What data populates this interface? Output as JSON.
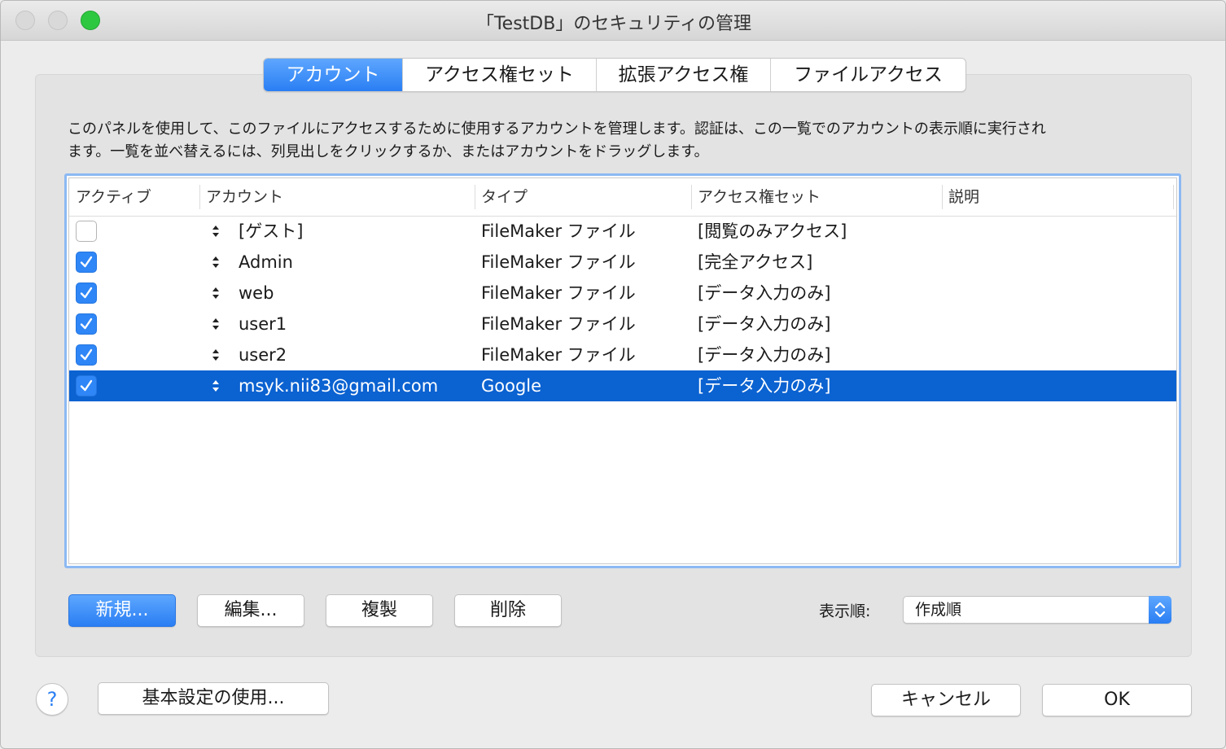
{
  "window": {
    "title": "「TestDB」のセキュリティの管理"
  },
  "tabs": [
    {
      "label": "アカウント",
      "active": true
    },
    {
      "label": "アクセス権セット",
      "active": false
    },
    {
      "label": "拡張アクセス権",
      "active": false
    },
    {
      "label": "ファイルアクセス",
      "active": false
    }
  ],
  "description": {
    "line1": "このパネルを使用して、このファイルにアクセスするために使用するアカウントを管理します。認証は、この一覧でのアカウントの表示順に実行され",
    "line2": "ます。一覧を並べ替えるには、列見出しをクリックするか、またはアカウントをドラッグします。"
  },
  "table": {
    "columns": {
      "active": "アクティブ",
      "account": "アカウント",
      "type": "タイプ",
      "privilege_set": "アクセス権セット",
      "description": "説明"
    },
    "rows": [
      {
        "active": false,
        "account": "[ゲスト]",
        "type": "FileMaker ファイル",
        "privilege_set": "[閲覧のみアクセス]",
        "description": "",
        "selected": false
      },
      {
        "active": true,
        "account": "Admin",
        "type": "FileMaker ファイル",
        "privilege_set": "[完全アクセス]",
        "description": "",
        "selected": false
      },
      {
        "active": true,
        "account": "web",
        "type": "FileMaker ファイル",
        "privilege_set": "[データ入力のみ]",
        "description": "",
        "selected": false
      },
      {
        "active": true,
        "account": "user1",
        "type": "FileMaker ファイル",
        "privilege_set": "[データ入力のみ]",
        "description": "",
        "selected": false
      },
      {
        "active": true,
        "account": "user2",
        "type": "FileMaker ファイル",
        "privilege_set": "[データ入力のみ]",
        "description": "",
        "selected": false
      },
      {
        "active": true,
        "account": "msyk.nii83@gmail.com",
        "type": "Google",
        "privilege_set": "[データ入力のみ]",
        "description": "",
        "selected": true
      }
    ]
  },
  "actions": {
    "new": "新規...",
    "edit": "編集...",
    "duplicate": "複製",
    "delete": "削除"
  },
  "sort": {
    "label": "表示順:",
    "value": "作成順"
  },
  "footer": {
    "help": "?",
    "use_preferences": "基本設定の使用...",
    "cancel": "キャンセル",
    "ok": "OK"
  },
  "colors": {
    "accent": "#2a7ef3",
    "selection": "#0b62d1",
    "zoom_button": "#2ec840"
  }
}
